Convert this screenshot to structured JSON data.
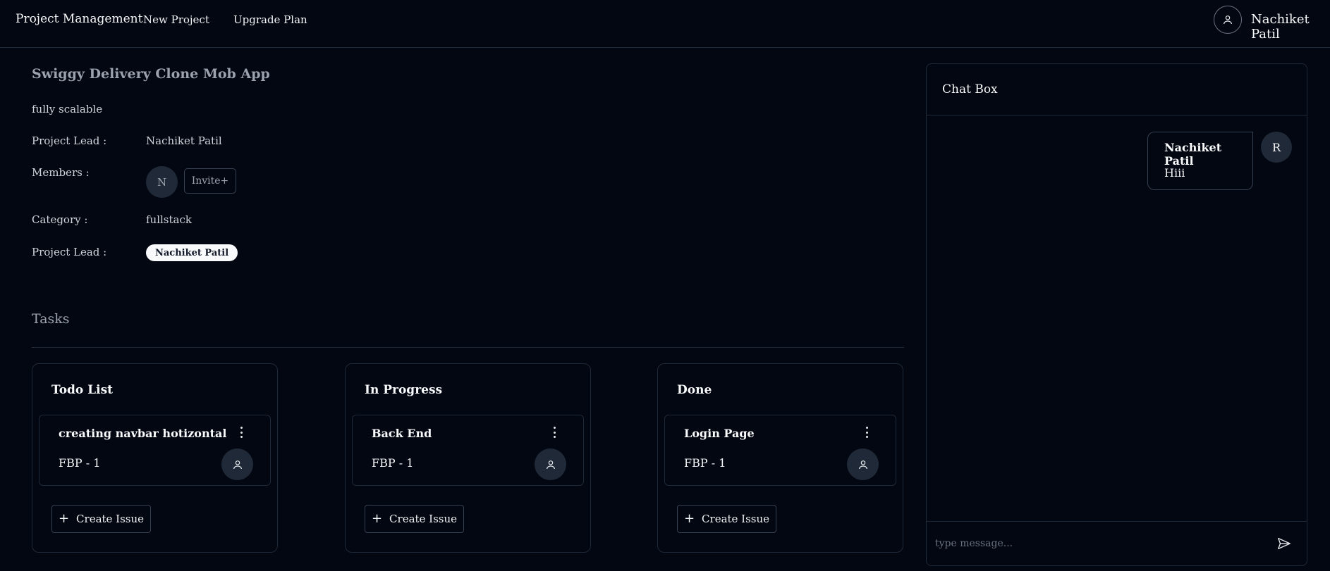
{
  "navbar": {
    "brand": "Project Management",
    "new_project": "New Project",
    "upgrade_plan": "Upgrade Plan",
    "user_name": "Nachiket Patil"
  },
  "project": {
    "title": "Swiggy Delivery Clone Mob App",
    "description": "fully scalable",
    "lead_label": "Project Lead :",
    "lead_value": "Nachiket Patil",
    "members_label": "Members :",
    "member_initial": "N",
    "invite_label": "Invite+",
    "category_label": "Category :",
    "category_value": "fullstack",
    "lead2_label": "Project Lead :",
    "lead2_badge": "Nachiket Patil"
  },
  "tasks": {
    "title": "Tasks",
    "columns": [
      {
        "title": "Todo List",
        "issue": {
          "title": "creating navbar hotizontal",
          "id": "FBP - 1"
        },
        "create_label": "Create Issue"
      },
      {
        "title": "In Progress",
        "issue": {
          "title": "Back End",
          "id": "FBP - 1"
        },
        "create_label": "Create Issue"
      },
      {
        "title": "Done",
        "issue": {
          "title": "Login Page",
          "id": "FBP - 1"
        },
        "create_label": "Create Issue"
      }
    ]
  },
  "chat": {
    "title": "Chat Box",
    "messages": [
      {
        "sender": "Nachiket Patil",
        "text": "Hiii",
        "avatar": "R"
      }
    ],
    "input_placeholder": "type message..."
  },
  "icons": {
    "user": "user-icon",
    "more": "more-vertical-icon",
    "plus": "plus-icon",
    "send": "send-icon"
  },
  "colors": {
    "background": "#030712",
    "border": "#1f2937",
    "text": "#f9fafb",
    "muted": "#9ca3af"
  }
}
